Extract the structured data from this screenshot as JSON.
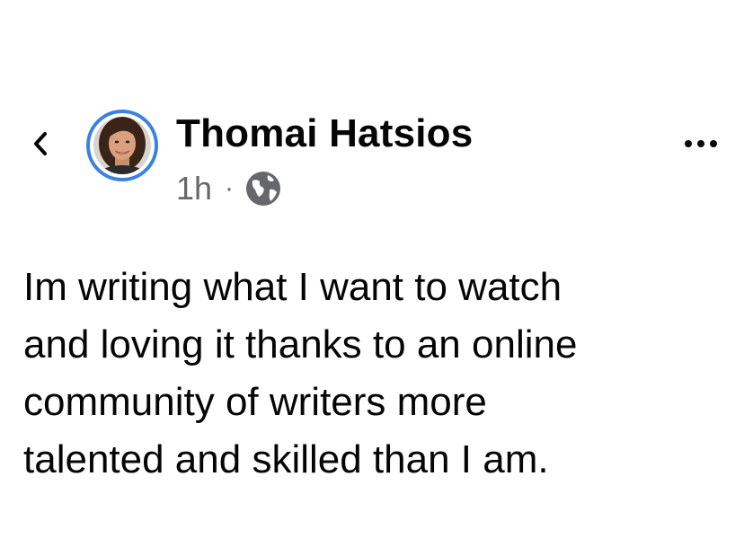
{
  "header": {
    "back_icon": "chevron-left-icon",
    "author_name": "Thomai Hatsios",
    "timestamp": "1h",
    "separator": "·",
    "audience_icon": "globe-icon",
    "more_icon": "more-horizontal-icon"
  },
  "post": {
    "lines": [
      "Im writing what I want to watch",
      "and loving it thanks to an online",
      "community of writers more",
      "talented and skilled than I am."
    ]
  },
  "colors": {
    "avatar_ring": "#3b82e0",
    "text_primary": "#050505",
    "text_secondary": "#65676b",
    "background": "#ffffff"
  }
}
